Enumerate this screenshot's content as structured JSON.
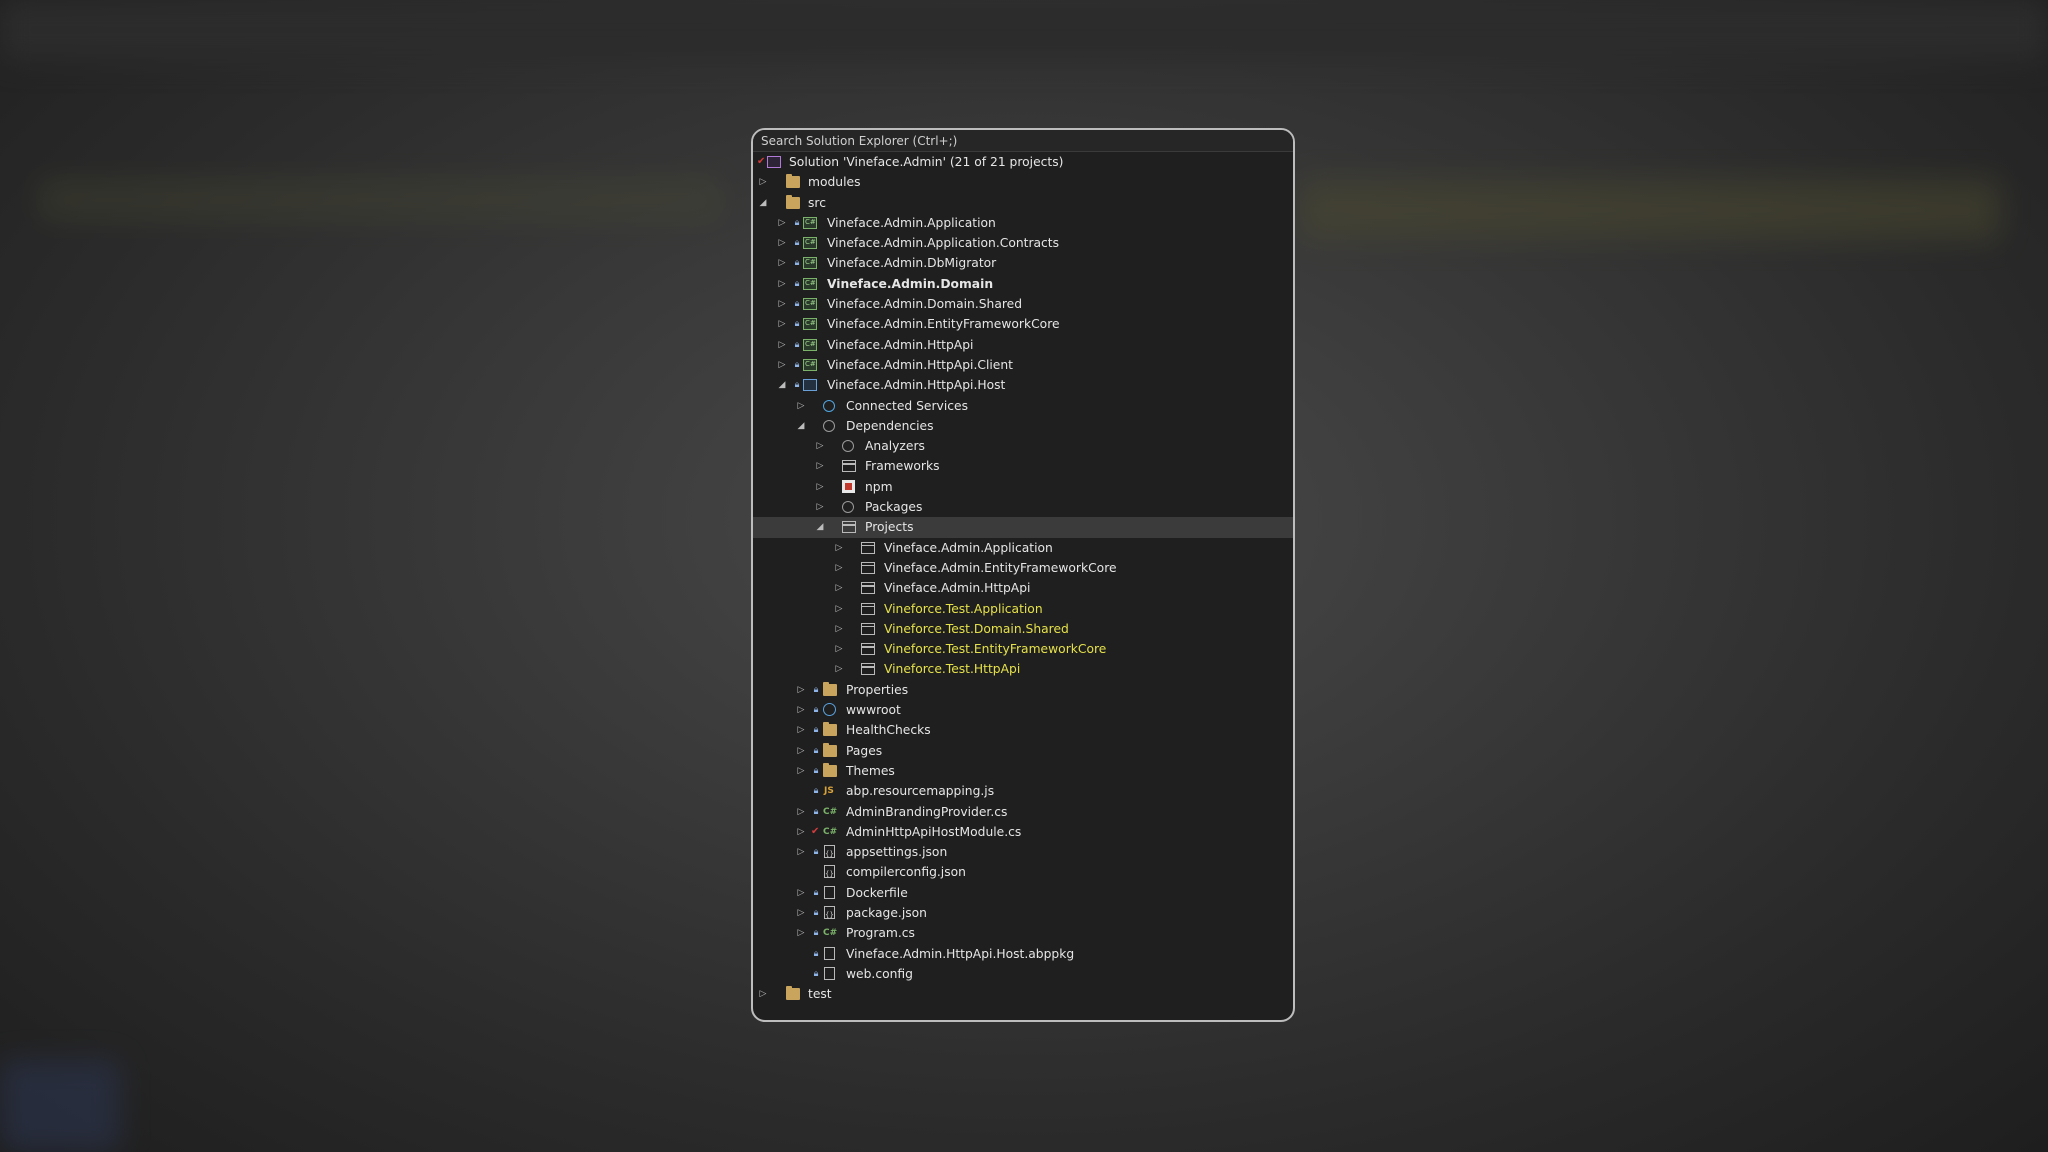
{
  "search": {
    "placeholder": "Search Solution Explorer (Ctrl+;)"
  },
  "tree": [
    {
      "label": "Solution 'Vineface.Admin' (21 of 21 projects)",
      "icon": "solution-icon"
    },
    {
      "label": "modules",
      "icon": "folder-icon"
    },
    {
      "label": "src",
      "icon": "folder-icon"
    },
    {
      "label": "Vineface.Admin.Application",
      "icon": "csharp-project-icon"
    },
    {
      "label": "Vineface.Admin.Application.Contracts",
      "icon": "csharp-project-icon"
    },
    {
      "label": "Vineface.Admin.DbMigrator",
      "icon": "csharp-project-icon"
    },
    {
      "label": "Vineface.Admin.Domain",
      "icon": "csharp-project-icon"
    },
    {
      "label": "Vineface.Admin.Domain.Shared",
      "icon": "csharp-project-icon"
    },
    {
      "label": "Vineface.Admin.EntityFrameworkCore",
      "icon": "csharp-project-icon"
    },
    {
      "label": "Vineface.Admin.HttpApi",
      "icon": "csharp-project-icon"
    },
    {
      "label": "Vineface.Admin.HttpApi.Client",
      "icon": "csharp-project-icon"
    },
    {
      "label": "Vineface.Admin.HttpApi.Host",
      "icon": "web-project-icon"
    },
    {
      "label": "Connected Services",
      "icon": "connected-services-icon"
    },
    {
      "label": "Dependencies",
      "icon": "dependencies-icon"
    },
    {
      "label": "Analyzers",
      "icon": "analyzers-icon"
    },
    {
      "label": "Frameworks",
      "icon": "frameworks-icon"
    },
    {
      "label": "npm",
      "icon": "npm-icon"
    },
    {
      "label": "Packages",
      "icon": "packages-icon"
    },
    {
      "label": "Projects",
      "icon": "project-reference-icon"
    },
    {
      "label": "Vineface.Admin.Application",
      "icon": "project-reference-icon"
    },
    {
      "label": "Vineface.Admin.EntityFrameworkCore",
      "icon": "project-reference-icon"
    },
    {
      "label": "Vineface.Admin.HttpApi",
      "icon": "project-reference-icon"
    },
    {
      "label": "Vineforce.Test.Application",
      "icon": "project-reference-icon"
    },
    {
      "label": "Vineforce.Test.Domain.Shared",
      "icon": "project-reference-icon"
    },
    {
      "label": "Vineforce.Test.EntityFrameworkCore",
      "icon": "project-reference-icon"
    },
    {
      "label": "Vineforce.Test.HttpApi",
      "icon": "project-reference-icon"
    },
    {
      "label": "Properties",
      "icon": "properties-folder-icon"
    },
    {
      "label": "wwwroot",
      "icon": "globe-icon"
    },
    {
      "label": "HealthChecks",
      "icon": "folder-icon"
    },
    {
      "label": "Pages",
      "icon": "folder-icon"
    },
    {
      "label": "Themes",
      "icon": "folder-icon"
    },
    {
      "label": "abp.resourcemapping.js",
      "icon": "js-file-icon"
    },
    {
      "label": "AdminBrandingProvider.cs",
      "icon": "csharp-file-icon"
    },
    {
      "label": "AdminHttpApiHostModule.cs",
      "icon": "csharp-file-icon"
    },
    {
      "label": "appsettings.json",
      "icon": "json-file-icon"
    },
    {
      "label": "compilerconfig.json",
      "icon": "json-file-icon"
    },
    {
      "label": "Dockerfile",
      "icon": "file-icon"
    },
    {
      "label": "package.json",
      "icon": "json-file-icon"
    },
    {
      "label": "Program.cs",
      "icon": "csharp-file-icon"
    },
    {
      "label": "Vineface.Admin.HttpApi.Host.abppkg",
      "icon": "file-icon"
    },
    {
      "label": "web.config",
      "icon": "config-file-icon"
    },
    {
      "label": "test",
      "icon": "folder-icon"
    }
  ],
  "icon_glyphs": {
    "js": "JS",
    "csharp": "C#"
  },
  "colors": {
    "highlight_text": "#e5e14a",
    "selected_row": "#3b3b3b",
    "panel_bg": "#1f1f1f",
    "panel_border": "#bdbdbd"
  }
}
